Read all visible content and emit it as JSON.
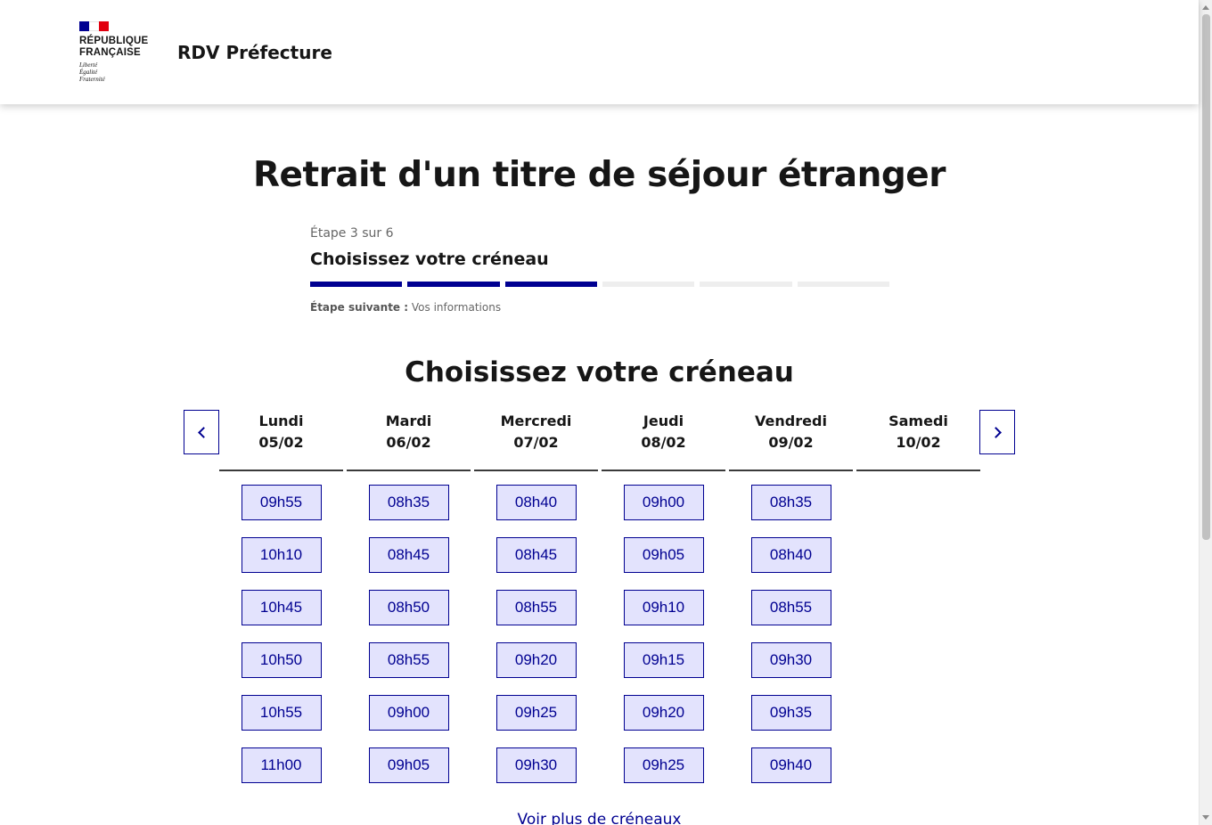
{
  "header": {
    "logo_line1": "RÉPUBLIQUE",
    "logo_line2": "FRANÇAISE",
    "motto_line1": "Liberté",
    "motto_line2": "Égalité",
    "motto_line3": "Fraternité",
    "service_title": "RDV Préfecture"
  },
  "page_title": "Retrait d'un titre de séjour étranger",
  "stepper": {
    "count": "Étape 3 sur 6",
    "title": "Choisissez votre créneau",
    "steps_total": 6,
    "steps_done": 3,
    "next_label": "Étape suivante :",
    "next_value": "Vos informations",
    "color_done": "#000091",
    "color_todo": "#eeeeee"
  },
  "section_title": "Choisissez votre créneau",
  "nav": {
    "prev_icon": "chevron-left-icon",
    "next_icon": "chevron-right-icon"
  },
  "days": [
    {
      "name": "Lundi",
      "date": "05/02",
      "slots": [
        "09h55",
        "10h10",
        "10h45",
        "10h50",
        "10h55",
        "11h00"
      ]
    },
    {
      "name": "Mardi",
      "date": "06/02",
      "slots": [
        "08h35",
        "08h45",
        "08h50",
        "08h55",
        "09h00",
        "09h05"
      ]
    },
    {
      "name": "Mercredi",
      "date": "07/02",
      "slots": [
        "08h40",
        "08h45",
        "08h55",
        "09h20",
        "09h25",
        "09h30"
      ]
    },
    {
      "name": "Jeudi",
      "date": "08/02",
      "slots": [
        "09h00",
        "09h05",
        "09h10",
        "09h15",
        "09h20",
        "09h25"
      ]
    },
    {
      "name": "Vendredi",
      "date": "09/02",
      "slots": [
        "08h35",
        "08h40",
        "08h55",
        "09h30",
        "09h35",
        "09h40"
      ]
    },
    {
      "name": "Samedi",
      "date": "10/02",
      "slots": []
    }
  ],
  "more_link": "Voir plus de créneaux",
  "colors": {
    "accent": "#000091",
    "slot_bg": "#e3e3fd",
    "flag_red": "#e1000f"
  }
}
